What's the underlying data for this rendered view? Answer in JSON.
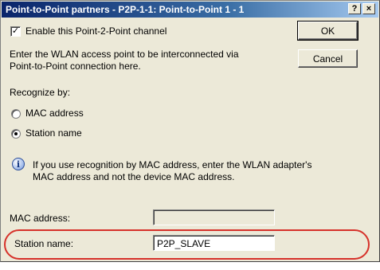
{
  "window": {
    "title": "Point-to-Point partners - P2P-1-1: Point-to-Point 1 - 1",
    "help_glyph": "?",
    "close_glyph": "×"
  },
  "buttons": {
    "ok_label": "OK",
    "cancel_label": "Cancel"
  },
  "enable_checkbox": {
    "label": "Enable this Point-2-Point channel",
    "checked_glyph": "✓"
  },
  "instructions": {
    "line1": "Enter the WLAN access point to be interconnected via",
    "line2": "Point-to-Point connection here."
  },
  "recognize": {
    "heading": "Recognize by:",
    "options": [
      {
        "label": "MAC address",
        "selected": false
      },
      {
        "label": "Station name",
        "selected": true
      }
    ]
  },
  "info": {
    "icon_glyph": "i",
    "line1": "If you use recognition by MAC address, enter the WLAN adapter's",
    "line2": "MAC address and not the device MAC address."
  },
  "mac_field": {
    "label": "MAC address:",
    "value": ""
  },
  "station_field": {
    "label": "Station name:",
    "value": "P2P_SLAVE"
  },
  "colors": {
    "highlight": "#d6312a",
    "titlebar_start": "#0a246a",
    "dialog_bg": "#ece9d8"
  }
}
